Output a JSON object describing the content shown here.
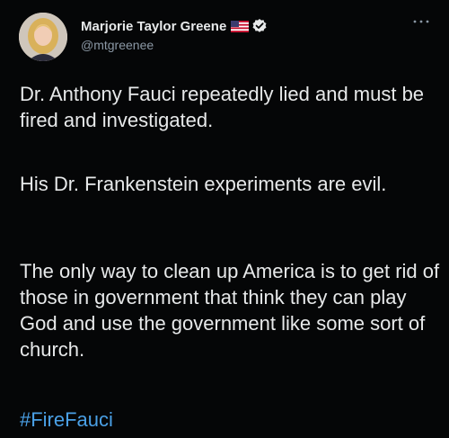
{
  "tweet": {
    "display_name": "Marjorie Taylor Greene",
    "handle": "@mtgreenee",
    "paragraphs": [
      "Dr. Anthony Fauci repeatedly lied and must be fired and investigated.",
      "His Dr. Frankenstein experiments are evil.",
      "The only way to clean up America is to get rid of those in government that think they can play God and use the government like some sort of church."
    ],
    "hashtag": "#FireFauci"
  },
  "icons": {
    "flag": "us-flag-icon",
    "verified": "verified-badge-icon",
    "more": "more-options-icon"
  },
  "colors": {
    "background": "#000000",
    "text": "#e7e9ea",
    "secondary_text": "#8b98a5",
    "link": "#4aa0e6"
  }
}
